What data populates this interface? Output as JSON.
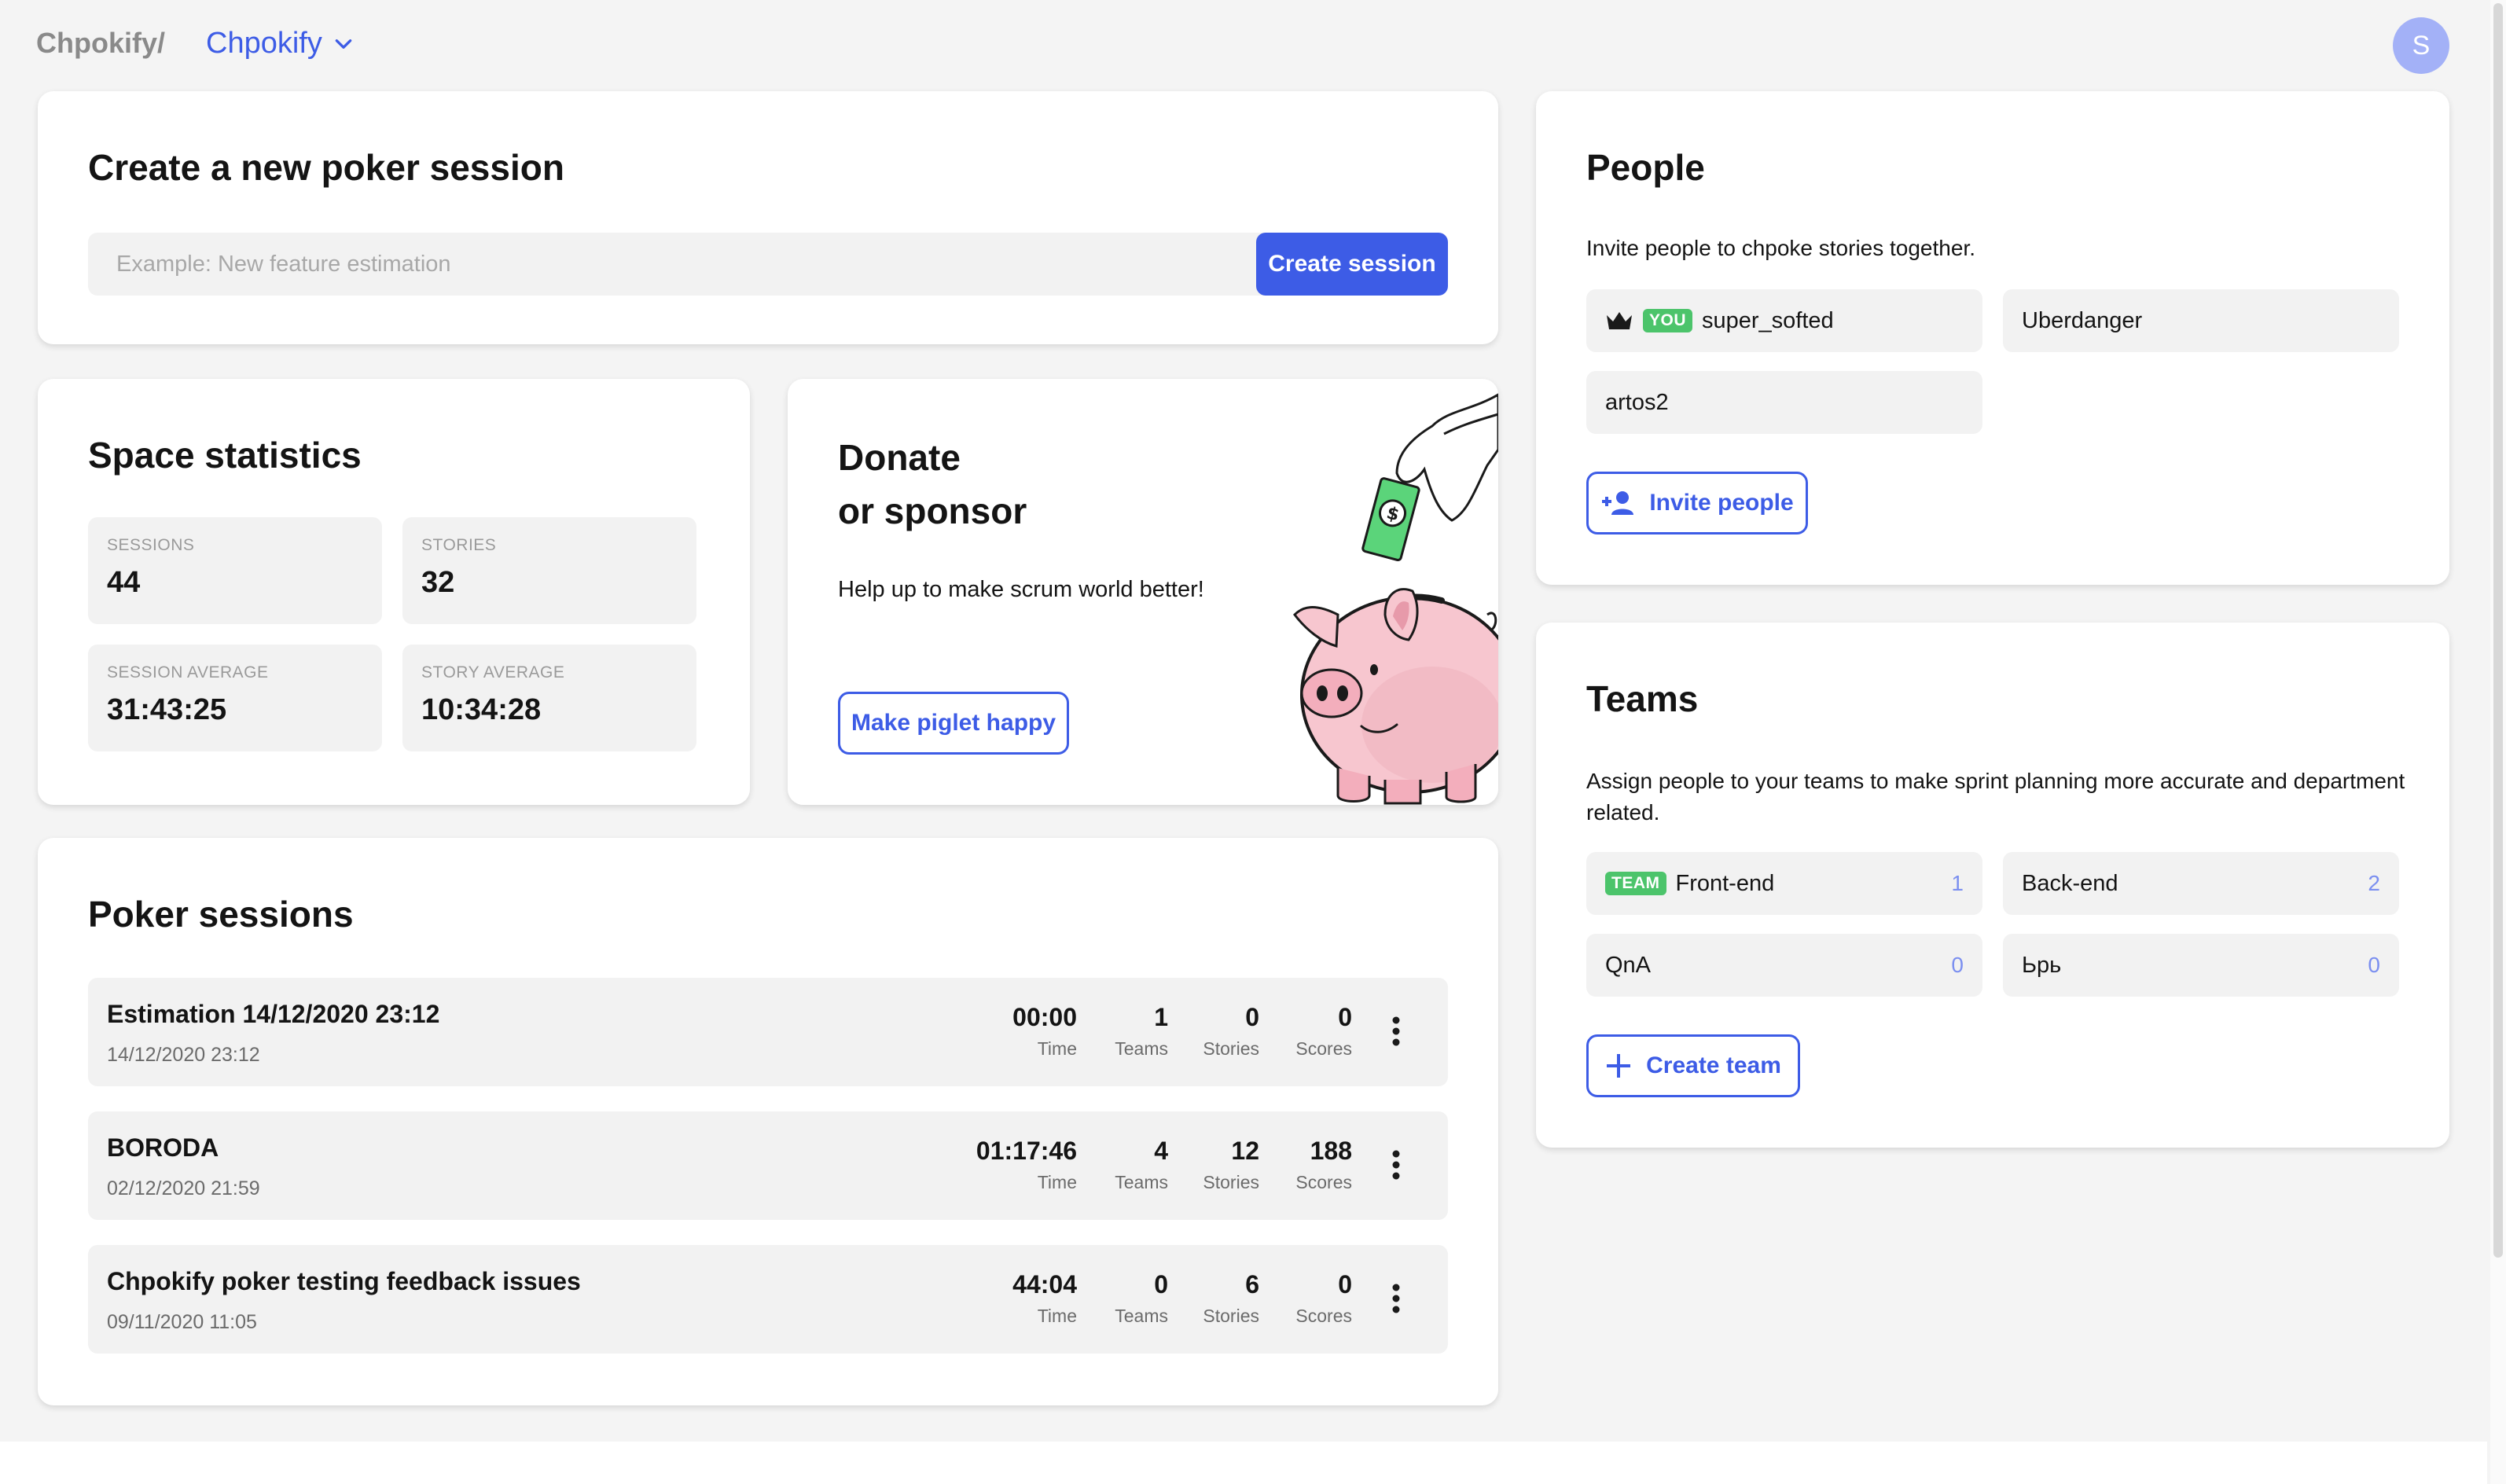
{
  "header": {
    "brand": "Chpokify/",
    "space_name": "Chpokify",
    "avatar_initial": "S"
  },
  "create_session": {
    "title": "Create a new poker session",
    "placeholder": "Example: New feature estimation",
    "button_label": "Create session"
  },
  "stats": {
    "title": "Space statistics",
    "items": [
      {
        "label": "SESSIONS",
        "value": "44"
      },
      {
        "label": "STORIES",
        "value": "32"
      },
      {
        "label": "SESSION AVERAGE",
        "value": "31:43:25"
      },
      {
        "label": "STORY AVERAGE",
        "value": "10:34:28"
      }
    ]
  },
  "donate": {
    "title_line1": "Donate",
    "title_line2": "or sponsor",
    "text": "Help up to make scrum world better!",
    "button_label": "Make piglet happy"
  },
  "sessions": {
    "title": "Poker sessions",
    "metric_labels": {
      "time": "Time",
      "teams": "Teams",
      "stories": "Stories",
      "scores": "Scores"
    },
    "rows": [
      {
        "name": "Estimation 14/12/2020 23:12",
        "date": "14/12/2020 23:12",
        "time": "00:00",
        "teams": "1",
        "stories": "0",
        "scores": "0"
      },
      {
        "name": "BORODA",
        "date": "02/12/2020 21:59",
        "time": "01:17:46",
        "teams": "4",
        "stories": "12",
        "scores": "188"
      },
      {
        "name": "Chpokify poker testing feedback issues",
        "date": "09/11/2020 11:05",
        "time": "44:04",
        "teams": "0",
        "stories": "6",
        "scores": "0"
      }
    ]
  },
  "people": {
    "title": "People",
    "description": "Invite people to chpoke stories together.",
    "you_badge": "YOU",
    "members": [
      "super_softed",
      "Uberdanger",
      "artos2"
    ],
    "invite_label": "Invite people"
  },
  "teams": {
    "title": "Teams",
    "description": "Assign people to your teams to make sprint planning more accurate and department related.",
    "team_badge": "TEAM",
    "items": [
      {
        "name": "Front-end",
        "count": "1"
      },
      {
        "name": "Back-end",
        "count": "2"
      },
      {
        "name": "QnA",
        "count": "0"
      },
      {
        "name": "Ьрь",
        "count": "0"
      }
    ],
    "create_label": "Create team"
  },
  "colors": {
    "accent": "#3d5ce6",
    "badge_green": "#4cc46b",
    "count_blue": "#7b8ff0",
    "avatar": "#a3b1f7"
  }
}
